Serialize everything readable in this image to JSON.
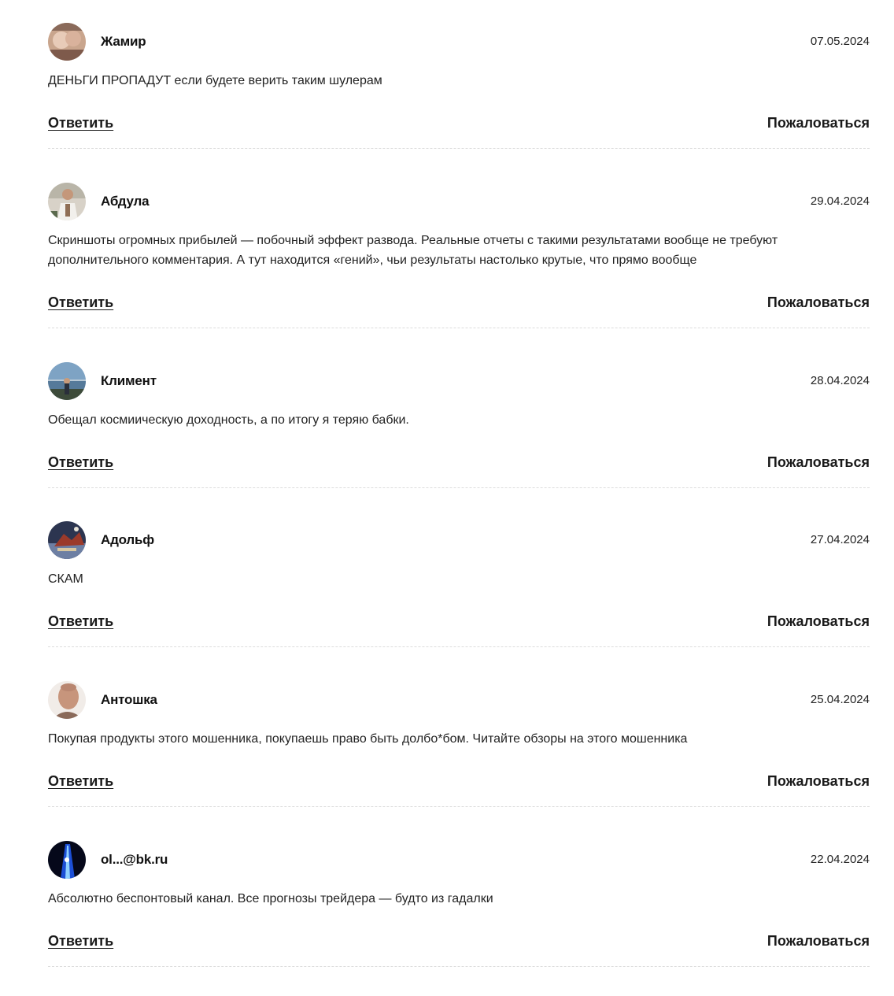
{
  "comments": [
    {
      "author": "Жамир",
      "date": "07.05.2024",
      "text": "ДЕНЬГИ ПРОПАДУТ если будете верить таким шулерам",
      "reply_label": "Ответить",
      "report_label": "Пожаловаться",
      "avatar_colors": [
        "#c9a58d",
        "#7e5a4b",
        "#e8cbb8"
      ]
    },
    {
      "author": "Абдула",
      "date": "29.04.2024",
      "text": "Скриншоты огромных прибылей — побочный эффект развода. Реальные отчеты с такими результатами вообще не требуют дополнительного комментария. А тут находится «гений», чьи результаты настолько крутые, что прямо вообще",
      "reply_label": "Ответить",
      "report_label": "Пожаловаться",
      "avatar_colors": [
        "#d8d2c8",
        "#8f6e55",
        "#f2f0ec"
      ]
    },
    {
      "author": "Климент",
      "date": "28.04.2024",
      "text": "Обещал космиическую доходность, а по итогу я теряю бабки.",
      "reply_label": "Ответить",
      "report_label": "Пожаловаться",
      "avatar_colors": [
        "#7ea3c4",
        "#3d4b3a",
        "#b9c9d6"
      ]
    },
    {
      "author": "Адольф",
      "date": "27.04.2024",
      "text": "СКАМ",
      "reply_label": "Ответить",
      "report_label": "Пожаловаться",
      "avatar_colors": [
        "#2c3550",
        "#9b3a2a",
        "#6d7fa3"
      ]
    },
    {
      "author": "Антошка",
      "date": "25.04.2024",
      "text": "Покупая продукты этого мошенника, покупаешь право быть долбо*бом. Читайте обзоры на этого мошенника",
      "reply_label": "Ответить",
      "report_label": "Пожаловаться",
      "avatar_colors": [
        "#f1ece8",
        "#c7957c",
        "#8a6a5a"
      ]
    },
    {
      "author": "ol...@bk.ru",
      "date": "22.04.2024",
      "text": "Абсолютно беспонтовый канал. Все прогнозы трейдера — будто из гадалки",
      "reply_label": "Ответить",
      "report_label": "Пожаловаться",
      "avatar_colors": [
        "#05081a",
        "#1c4fd6",
        "#8fd0ff"
      ]
    }
  ]
}
